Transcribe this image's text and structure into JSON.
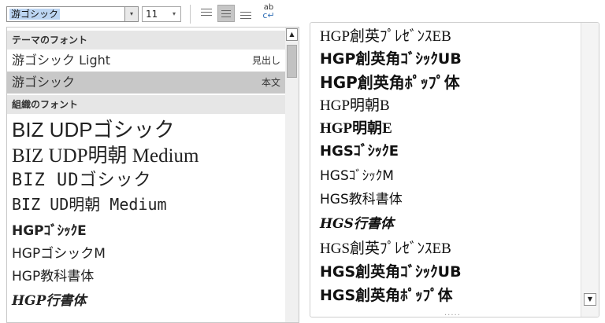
{
  "toolbar": {
    "font_name_value": "游ゴシック",
    "font_size_value": "11",
    "dropdown_arrow": "▾",
    "wrap_text_top": "ab",
    "wrap_text_bottom": "c↵"
  },
  "font_menu": {
    "theme_fonts_header": "テーマのフォント",
    "theme_fonts": [
      {
        "name": "游ゴシック Light",
        "tag": "見出し"
      },
      {
        "name": "游ゴシック",
        "tag": "本文"
      }
    ],
    "all_fonts_header": "組織のフォント",
    "all_fonts": [
      "BIZ UDPゴシック",
      "BIZ UDP明朝 Medium",
      "BIZ UDゴシック",
      "BIZ UD明朝 Medium",
      "HGPｺﾞｼｯｸE",
      "HGPゴシックM",
      "HGP教科書体",
      "HGP行書体"
    ],
    "scroll_up_glyph": "▲"
  },
  "font_list_continued": {
    "items": [
      "HGP創英ﾌﾟﾚｾﾞﾝｽEB",
      "HGP創英角ｺﾞｼｯｸUB",
      "HGP創英角ﾎﾟｯﾌﾟ体",
      "HGP明朝B",
      "HGP明朝E",
      "HGSｺﾞｼｯｸE",
      "HGSｺﾞｼｯｸM",
      "HGS教科書体",
      "HGS行書体",
      "HGS創英ﾌﾟﾚｾﾞﾝｽEB",
      "HGS創英角ｺﾞｼｯｸUB",
      "HGS創英角ﾎﾟｯﾌﾟ体"
    ],
    "scroll_down_glyph": "▼",
    "resize_grip": "....."
  },
  "colors": {
    "selection_highlight": "#bcd5f2",
    "selected_row": "#c8c8c8",
    "section_header_bg": "#e6e6e6"
  }
}
